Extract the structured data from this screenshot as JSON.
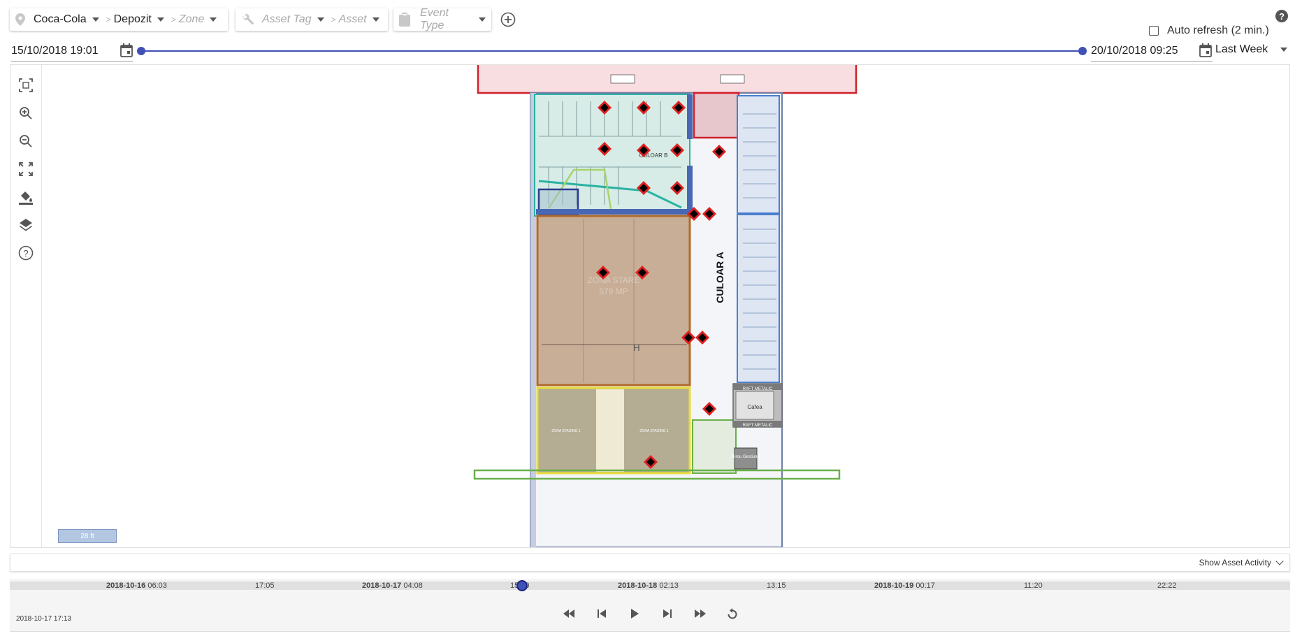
{
  "filters": {
    "client": "Coca-Cola",
    "site": "Depozit",
    "zone_placeholder": "Zone",
    "asset_tag_placeholder": "Asset Tag",
    "asset_placeholder": "Asset",
    "event_type_placeholder": "Event Type"
  },
  "header": {
    "auto_refresh_label": "Auto refresh (2 min.)",
    "auto_refresh_checked": false,
    "help_icon": "help-circle-icon"
  },
  "date_range": {
    "start": "15/10/2018 19:01",
    "end": "20/10/2018 09:25",
    "preset": "Last Week"
  },
  "map": {
    "zone_label": "ZONA STARE",
    "zone_area": "579 MP",
    "corridor_a": "CULOAR A",
    "corridor_b": "CULOAR B",
    "cafe_label": "Cafea",
    "office_label": "Birou Gestiune",
    "rack_label": "RAFT METALIC",
    "staging_1": "ZONA STAGING 1",
    "staging_2": "ZONA STAGING 1",
    "staging_h": "H",
    "scale": "28 ft"
  },
  "tools": [
    {
      "name": "select-area-icon"
    },
    {
      "name": "zoom-in-icon"
    },
    {
      "name": "zoom-out-icon"
    },
    {
      "name": "fit-screen-icon"
    },
    {
      "name": "fill-color-icon"
    },
    {
      "name": "layers-icon"
    },
    {
      "name": "help-icon"
    }
  ],
  "activity": {
    "toggle_label": "Show Asset Activity"
  },
  "timeline": {
    "ticks": [
      {
        "date": "2018-10-16",
        "time": "06:03"
      },
      {
        "date": "",
        "time": "17:05"
      },
      {
        "date": "2018-10-17",
        "time": "04:08"
      },
      {
        "date": "",
        "time": "15:10"
      },
      {
        "date": "2018-10-18",
        "time": "02:13"
      },
      {
        "date": "",
        "time": "13:15"
      },
      {
        "date": "2018-10-19",
        "time": "00:17"
      },
      {
        "date": "",
        "time": "11:20"
      },
      {
        "date": "",
        "time": "22:22"
      }
    ],
    "current": "2018-10-17 17:13",
    "position": 0.4
  },
  "colors": {
    "primary": "#3f51b5",
    "marker_fill": "#000000",
    "marker_stroke": "#e02020"
  }
}
